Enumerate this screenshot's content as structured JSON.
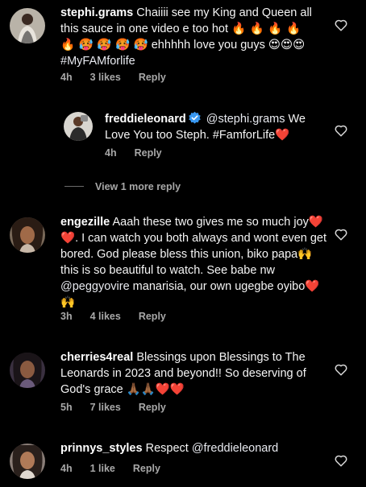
{
  "comments": [
    {
      "username": "stephi.grams",
      "text_a": " Chaiiii see my King and Queen all this sauce in one video e too hot ",
      "emojis_a": "🔥 🔥 🔥 🔥 🔥 🥵 🥵 🥵 🥵",
      "text_b": " ehhhhh love you guys ",
      "emojis_b": "😍😍😍",
      "hashtag": " #MyFAMforlife",
      "time": "4h",
      "likes": "3 likes",
      "reply": "Reply"
    },
    {
      "username": "freddieleonard",
      "mention": "@stephi.grams",
      "text": " We Love You too Steph. #FamforLife",
      "emojis": "❤️",
      "time": "4h",
      "reply": "Reply"
    },
    {
      "username": "engezille",
      "text_a": " Aaah these two gives me so much joy",
      "emojis_a": "❤️❤️",
      "text_b": ". I can watch you both always and wont even get bored. God please bless this union, biko papa",
      "emojis_b": "🙌",
      "text_c": " this is so beautiful to watch. See babe nw ",
      "mention": "@peggyovire",
      "text_d": " manarisia, our own ugegbe oyibo",
      "emojis_d": "❤️🙌",
      "time": "3h",
      "likes": "4 likes",
      "reply": "Reply"
    },
    {
      "username": "cherries4real",
      "text": " Blessings upon Blessings to The Leonards in 2023 and beyond!! So deserving of God's grace ",
      "emojis": "🙏🏾🙏🏾❤️❤️",
      "time": "5h",
      "likes": "7 likes",
      "reply": "Reply"
    },
    {
      "username": "prinnys_styles",
      "text": " Respect ",
      "mention": "@freddieleonard",
      "time": "4h",
      "likes": "1 like",
      "reply": "Reply"
    }
  ],
  "view_more": "View 1 more reply",
  "colors": {
    "background": "#000000",
    "text": "#f5f5f5",
    "meta": "#a8a8a8",
    "verified": "#3897f0",
    "heart_emoji": "#e0245e"
  },
  "icons": {
    "like": "heart-outline-icon",
    "verified": "verified-badge-icon"
  }
}
